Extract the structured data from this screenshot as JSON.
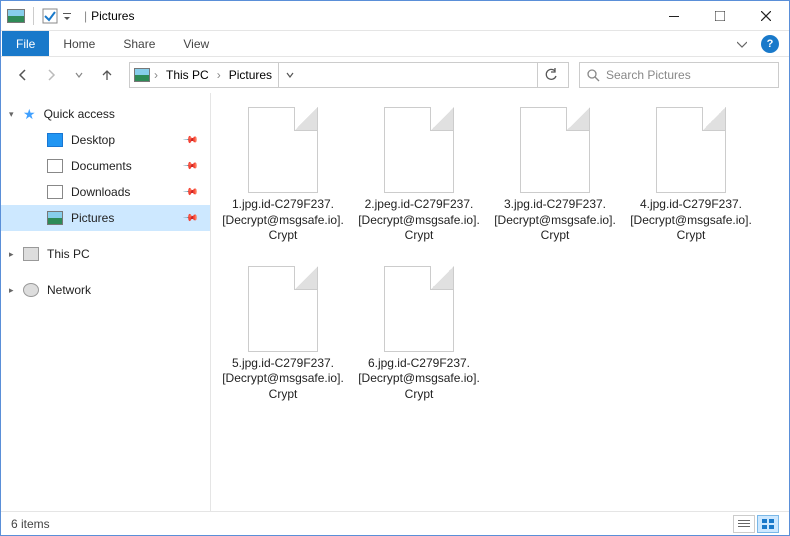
{
  "window": {
    "title": "Pictures",
    "qat_checked": true
  },
  "ribbon": {
    "file_label": "File",
    "tabs": [
      "Home",
      "Share",
      "View"
    ]
  },
  "nav": {
    "breadcrumbs": [
      "This PC",
      "Pictures"
    ],
    "search_placeholder": "Search Pictures"
  },
  "sidebar": {
    "quick_access": "Quick access",
    "pinned": [
      {
        "label": "Desktop",
        "icon": "desktop"
      },
      {
        "label": "Documents",
        "icon": "doc"
      },
      {
        "label": "Downloads",
        "icon": "down"
      },
      {
        "label": "Pictures",
        "icon": "pic",
        "selected": true
      }
    ],
    "this_pc": "This PC",
    "network": "Network"
  },
  "files": [
    "1.jpg.id-C279F237.[Decrypt@msgsafe.io].Crypt",
    "2.jpeg.id-C279F237.[Decrypt@msgsafe.io].Crypt",
    "3.jpg.id-C279F237.[Decrypt@msgsafe.io].Crypt",
    "4.jpg.id-C279F237.[Decrypt@msgsafe.io].Crypt",
    "5.jpg.id-C279F237.[Decrypt@msgsafe.io].Crypt",
    "6.jpg.id-C279F237.[Decrypt@msgsafe.io].Crypt"
  ],
  "status": {
    "count_text": "6 items"
  }
}
